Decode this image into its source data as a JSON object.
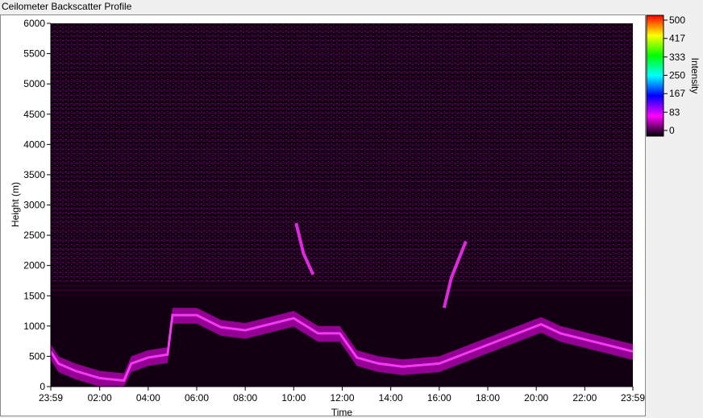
{
  "window": {
    "title": "Ceilometer Backscatter Profile"
  },
  "chart_data": {
    "type": "heatmap",
    "title": "",
    "xlabel": "Time",
    "ylabel": "Height (m)",
    "colorbar_label": "Intensity",
    "xlim": [
      -0.0167,
      23.9833
    ],
    "ylim": [
      0,
      6000
    ],
    "x_ticks": [
      {
        "value": -0.0167,
        "label": "23:59"
      },
      {
        "value": 2,
        "label": "02:00"
      },
      {
        "value": 4,
        "label": "04:00"
      },
      {
        "value": 6,
        "label": "06:00"
      },
      {
        "value": 8,
        "label": "08:00"
      },
      {
        "value": 10,
        "label": "10:00"
      },
      {
        "value": 12,
        "label": "12:00"
      },
      {
        "value": 14,
        "label": "14:00"
      },
      {
        "value": 16,
        "label": "16:00"
      },
      {
        "value": 18,
        "label": "18:00"
      },
      {
        "value": 20,
        "label": "20:00"
      },
      {
        "value": 22,
        "label": "22:00"
      },
      {
        "value": 23.9833,
        "label": "23:59"
      }
    ],
    "y_ticks": [
      {
        "value": 0,
        "label": "0"
      },
      {
        "value": 500,
        "label": "500"
      },
      {
        "value": 1000,
        "label": "1000"
      },
      {
        "value": 1500,
        "label": "1500"
      },
      {
        "value": 2000,
        "label": "2000"
      },
      {
        "value": 2500,
        "label": "2500"
      },
      {
        "value": 3000,
        "label": "3000"
      },
      {
        "value": 3500,
        "label": "3500"
      },
      {
        "value": 4000,
        "label": "4000"
      },
      {
        "value": 4500,
        "label": "4500"
      },
      {
        "value": 5000,
        "label": "5000"
      },
      {
        "value": 5500,
        "label": "5500"
      },
      {
        "value": 6000,
        "label": "6000"
      }
    ],
    "colorbar": {
      "range": [
        0,
        500
      ],
      "ticks": [
        {
          "value": 500,
          "label": "500"
        },
        {
          "value": 417,
          "label": "417"
        },
        {
          "value": 333,
          "label": "333"
        },
        {
          "value": 250,
          "label": "250"
        },
        {
          "value": 167,
          "label": "167"
        },
        {
          "value": 83,
          "label": "83"
        },
        {
          "value": 0,
          "label": "0"
        }
      ],
      "stops": [
        {
          "value": 0,
          "color": "#000000"
        },
        {
          "value": 83,
          "color": "#ff00ff"
        },
        {
          "value": 167,
          "color": "#0000ff"
        },
        {
          "value": 250,
          "color": "#00ffff"
        },
        {
          "value": 333,
          "color": "#00ff00"
        },
        {
          "value": 417,
          "color": "#ffff00"
        },
        {
          "value": 500,
          "color": "#ff0000"
        }
      ]
    },
    "layers": {
      "boundary_layer": [
        {
          "t": -0.0167,
          "h": 700
        },
        {
          "t": 0.3,
          "h": 500
        },
        {
          "t": 1,
          "h": 380
        },
        {
          "t": 2,
          "h": 260
        },
        {
          "t": 3,
          "h": 220
        },
        {
          "t": 3.3,
          "h": 500
        },
        {
          "t": 4,
          "h": 600
        },
        {
          "t": 4.8,
          "h": 650
        },
        {
          "t": 5,
          "h": 1300
        },
        {
          "t": 6,
          "h": 1300
        },
        {
          "t": 7,
          "h": 1100
        },
        {
          "t": 8,
          "h": 1050
        },
        {
          "t": 9,
          "h": 1150
        },
        {
          "t": 10,
          "h": 1250
        },
        {
          "t": 11,
          "h": 1000
        },
        {
          "t": 11.9,
          "h": 1000
        },
        {
          "t": 12.6,
          "h": 600
        },
        {
          "t": 13.5,
          "h": 500
        },
        {
          "t": 14.5,
          "h": 450
        },
        {
          "t": 16,
          "h": 500
        },
        {
          "t": 20.2,
          "h": 1150
        },
        {
          "t": 21,
          "h": 1000
        },
        {
          "t": 22,
          "h": 900
        },
        {
          "t": 23,
          "h": 800
        },
        {
          "t": 23.9833,
          "h": 700
        }
      ],
      "rising_layer": [
        {
          "t": 16.2,
          "h": 1300
        },
        {
          "t": 16.5,
          "h": 1800
        },
        {
          "t": 16.8,
          "h": 2100
        },
        {
          "t": 17.1,
          "h": 2400
        }
      ],
      "descending_layer": [
        {
          "t": 10.1,
          "h": 2700
        },
        {
          "t": 10.4,
          "h": 2200
        },
        {
          "t": 10.8,
          "h": 1850
        }
      ]
    }
  }
}
